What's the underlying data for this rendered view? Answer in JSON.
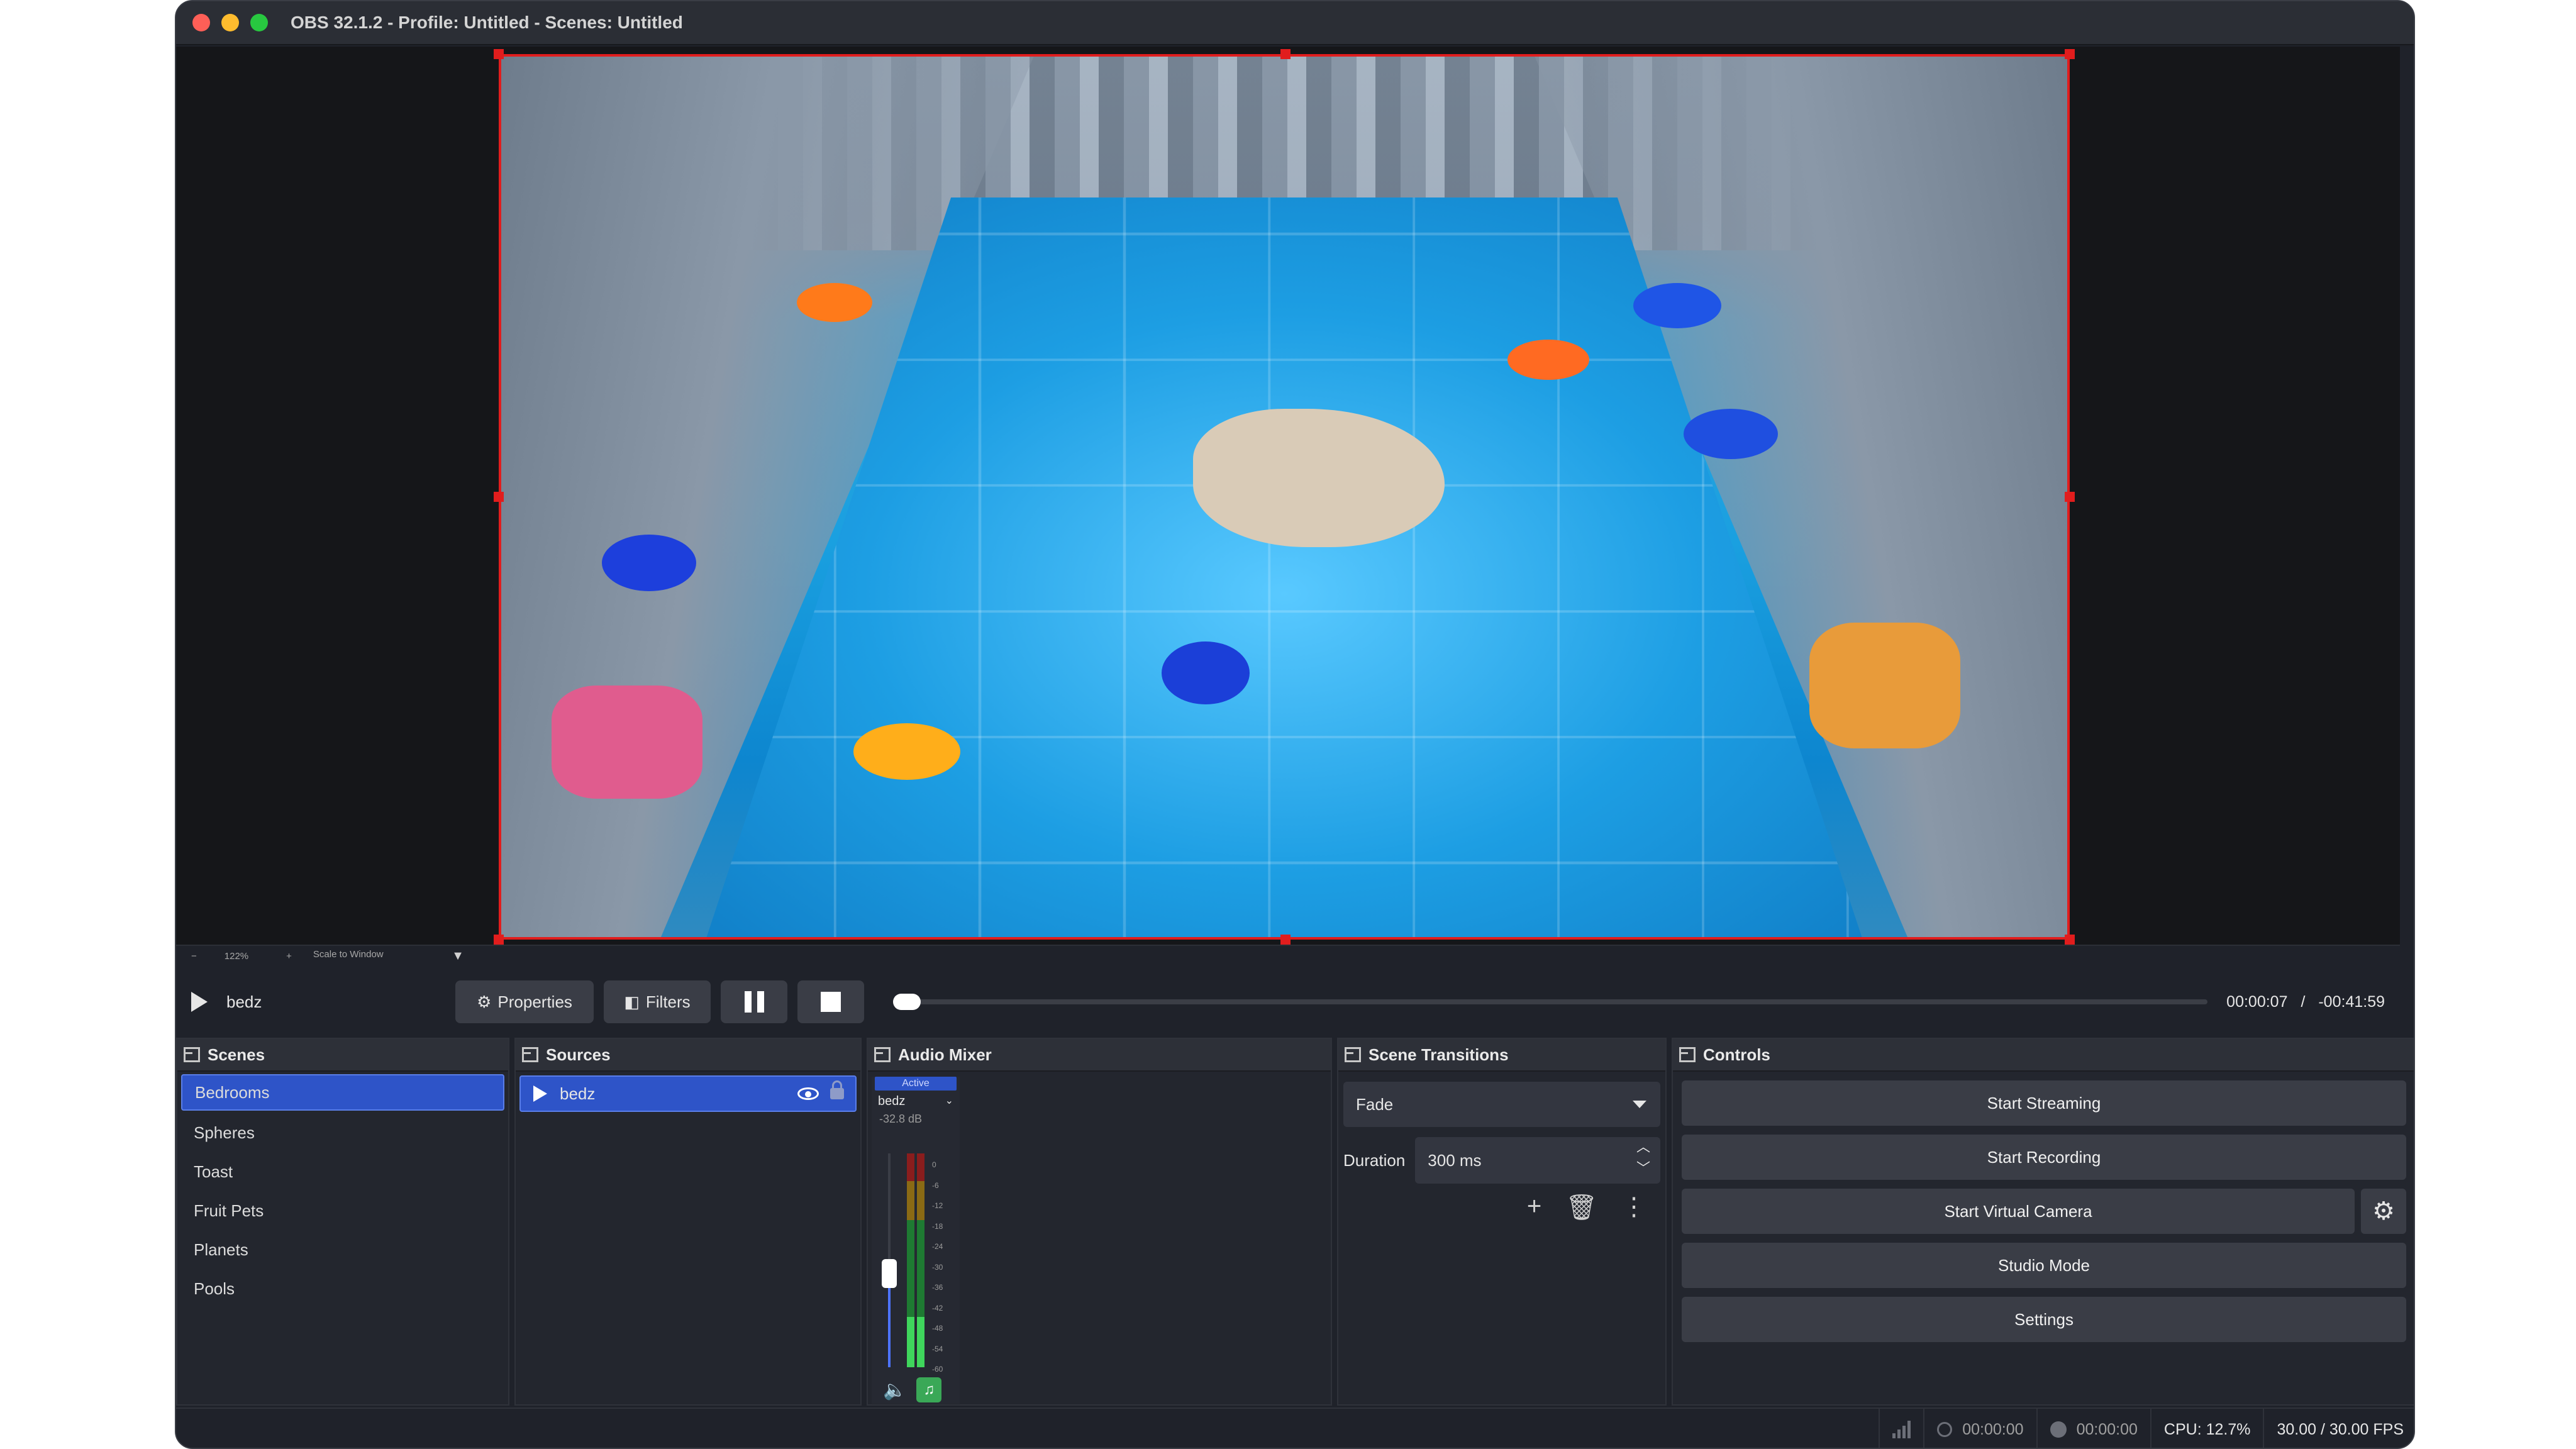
{
  "window": {
    "title": "OBS 32.1.2 - Profile: Untitled - Scenes: Untitled"
  },
  "zoom": {
    "minus": "−",
    "level": "122%",
    "plus": "+",
    "mode": "Scale to Window"
  },
  "transport": {
    "media_name": "bedz",
    "properties_label": "Properties",
    "filters_label": "Filters",
    "elapsed": "00:00:07",
    "separator": "/",
    "remaining": "-00:41:59",
    "seek_fraction": 0.0
  },
  "scenes": {
    "title": "Scenes",
    "items": [
      "Bedrooms",
      "Spheres",
      "Toast",
      "Fruit Pets",
      "Planets",
      "Pools"
    ],
    "selected": "Bedrooms"
  },
  "sources": {
    "title": "Sources",
    "items": [
      {
        "name": "bedz"
      }
    ]
  },
  "mixer": {
    "title": "Audio Mixer",
    "strip": {
      "badge": "Active",
      "name": "bedz",
      "db": "-32.8 dB",
      "scale": [
        "0",
        "-6",
        "-12",
        "-18",
        "-24",
        "-30",
        "-36",
        "-42",
        "-48",
        "-54",
        "-60"
      ]
    }
  },
  "transitions": {
    "title": "Scene Transitions",
    "selected": "Fade",
    "duration_label": "Duration",
    "duration_value": "300 ms"
  },
  "controls": {
    "title": "Controls",
    "start_streaming": "Start Streaming",
    "start_recording": "Start Recording",
    "start_virtual_camera": "Start Virtual Camera",
    "studio_mode": "Studio Mode",
    "settings": "Settings"
  },
  "status": {
    "stream_time": "00:00:00",
    "record_time": "00:00:00",
    "cpu": "CPU: 12.7%",
    "fps": "30.00 / 30.00 FPS"
  },
  "colors": {
    "selection": "#2e54c8",
    "preview_border": "#e11d1d",
    "background": "#1f222a"
  }
}
